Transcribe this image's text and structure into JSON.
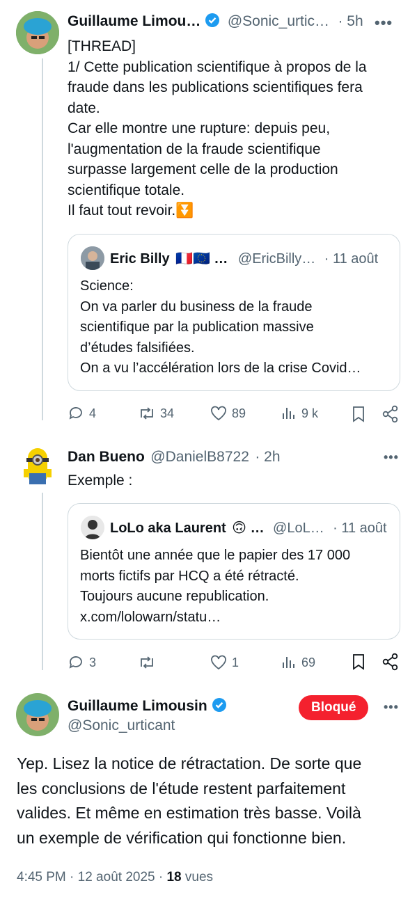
{
  "tweet1": {
    "author_name": "Guillaume Limou…",
    "author_handle": "@Sonic_urtic…",
    "time": "· 5h",
    "lines": [
      "[THREAD]",
      "1/ Cette publication scientifique à propos de la",
      "fraude dans les publications scientifiques fera",
      "date.",
      "Car elle montre une rupture: depuis peu,",
      "l'augmentation de la fraude scientifique",
      "surpasse largement celle de la production",
      "scientifique totale.",
      "Il faut tout revoir."
    ],
    "emoji": "⏬",
    "quote": {
      "author_name": "Eric Billy",
      "flags": "🇫🇷🇪🇺 …",
      "author_handle": "@EricBilly…",
      "time": "· 11 août",
      "lines": [
        "Science:",
        "On va parler du business de la fraude",
        "scientifique par la publication massive",
        "d’études falsifiées.",
        "On a vu l’accélération lors de la crise Covid…"
      ]
    },
    "actions": {
      "replies": "4",
      "reposts": "34",
      "likes": "89",
      "views": "9 k"
    }
  },
  "tweet2": {
    "author_name": "Dan Bueno",
    "author_handle": "@DanielB8722",
    "time": "· 2h",
    "text": "Exemple :",
    "quote": {
      "author_name": "LoLo aka Laurent",
      "emoji": "🙃 …",
      "author_handle": "@LoL…",
      "time": "· 11 août",
      "lines": [
        "Bientôt une année que le papier des 17 000",
        "morts fictifs par HCQ a été rétracté.",
        "Toujours aucune republication.",
        "x.com/lolowarn/statu…"
      ]
    },
    "actions": {
      "replies": "3",
      "reposts": "",
      "likes": "1",
      "views": "69"
    }
  },
  "main_tweet": {
    "author_name": "Guillaume Limousin",
    "author_handle": "@Sonic_urticant",
    "blocked_label": "Bloqué",
    "lines": [
      "Yep. Lisez la notice de rétractation. De sorte que",
      "les conclusions de l'étude restent parfaitement",
      "valides. Et même en estimation très basse. Voilà",
      "un exemple de vérification qui fonctionne bien."
    ],
    "timestamp": "4:45 PM · 12 août 2025 ·",
    "views_count": "18",
    "views_label": "vues"
  },
  "colors": {
    "accent": "#1d9bf0",
    "blocked": "#f4212e",
    "muted": "#536471"
  }
}
